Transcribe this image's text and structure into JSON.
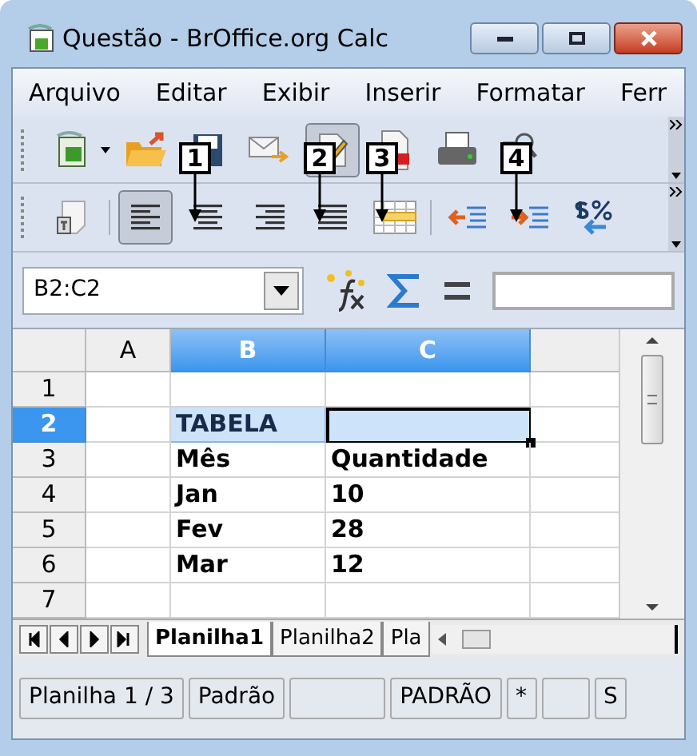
{
  "window": {
    "title": "Questão - BrOffice.org Calc"
  },
  "menu": [
    "Arquivo",
    "Editar",
    "Exibir",
    "Inserir",
    "Formatar",
    "Ferr"
  ],
  "toolbar_standard": [
    {
      "kind": "new",
      "selected": false
    },
    {
      "kind": "open",
      "selected": false
    },
    {
      "kind": "save",
      "selected": false
    },
    {
      "kind": "email",
      "selected": false
    },
    {
      "kind": "edit",
      "selected": true
    },
    {
      "kind": "pdf",
      "selected": false
    },
    {
      "kind": "print",
      "selected": false
    },
    {
      "kind": "preview",
      "selected": false
    }
  ],
  "toolbar_format": [
    {
      "kind": "styles",
      "selected": false
    },
    {
      "kind": "align-left",
      "selected": true
    },
    {
      "kind": "align-center",
      "selected": false
    },
    {
      "kind": "align-right",
      "selected": false
    },
    {
      "kind": "justify",
      "selected": false
    },
    {
      "kind": "merge",
      "selected": false
    },
    {
      "kind": "indent-decrease",
      "selected": false
    },
    {
      "kind": "indent-increase",
      "selected": false
    },
    {
      "kind": "number-format",
      "selected": false
    }
  ],
  "callouts": [
    "1",
    "2",
    "3",
    "4"
  ],
  "name_box": "B2:C2",
  "columns": [
    {
      "label": "A",
      "selected": false
    },
    {
      "label": "B",
      "selected": true
    },
    {
      "label": "C",
      "selected": true
    }
  ],
  "rows": [
    {
      "number": "1",
      "selected": false
    },
    {
      "number": "2",
      "selected": true,
      "b": "TABELA"
    },
    {
      "number": "3",
      "selected": false,
      "b": "Mês",
      "c": "Quantidade"
    },
    {
      "number": "4",
      "selected": false,
      "b": "Jan",
      "c": "10"
    },
    {
      "number": "5",
      "selected": false,
      "b": "Fev",
      "c": "28"
    },
    {
      "number": "6",
      "selected": false,
      "b": "Mar",
      "c": "12"
    },
    {
      "number": "7",
      "selected": false
    }
  ],
  "sheet_tabs": [
    {
      "label": "Planilha1",
      "selected": true
    },
    {
      "label": "Planilha2",
      "selected": false
    },
    {
      "label": "Pla",
      "selected": false
    }
  ],
  "status_bar": [
    "Planilha 1 / 3",
    "Padrão",
    "PADRÃO",
    "*",
    "S"
  ]
}
